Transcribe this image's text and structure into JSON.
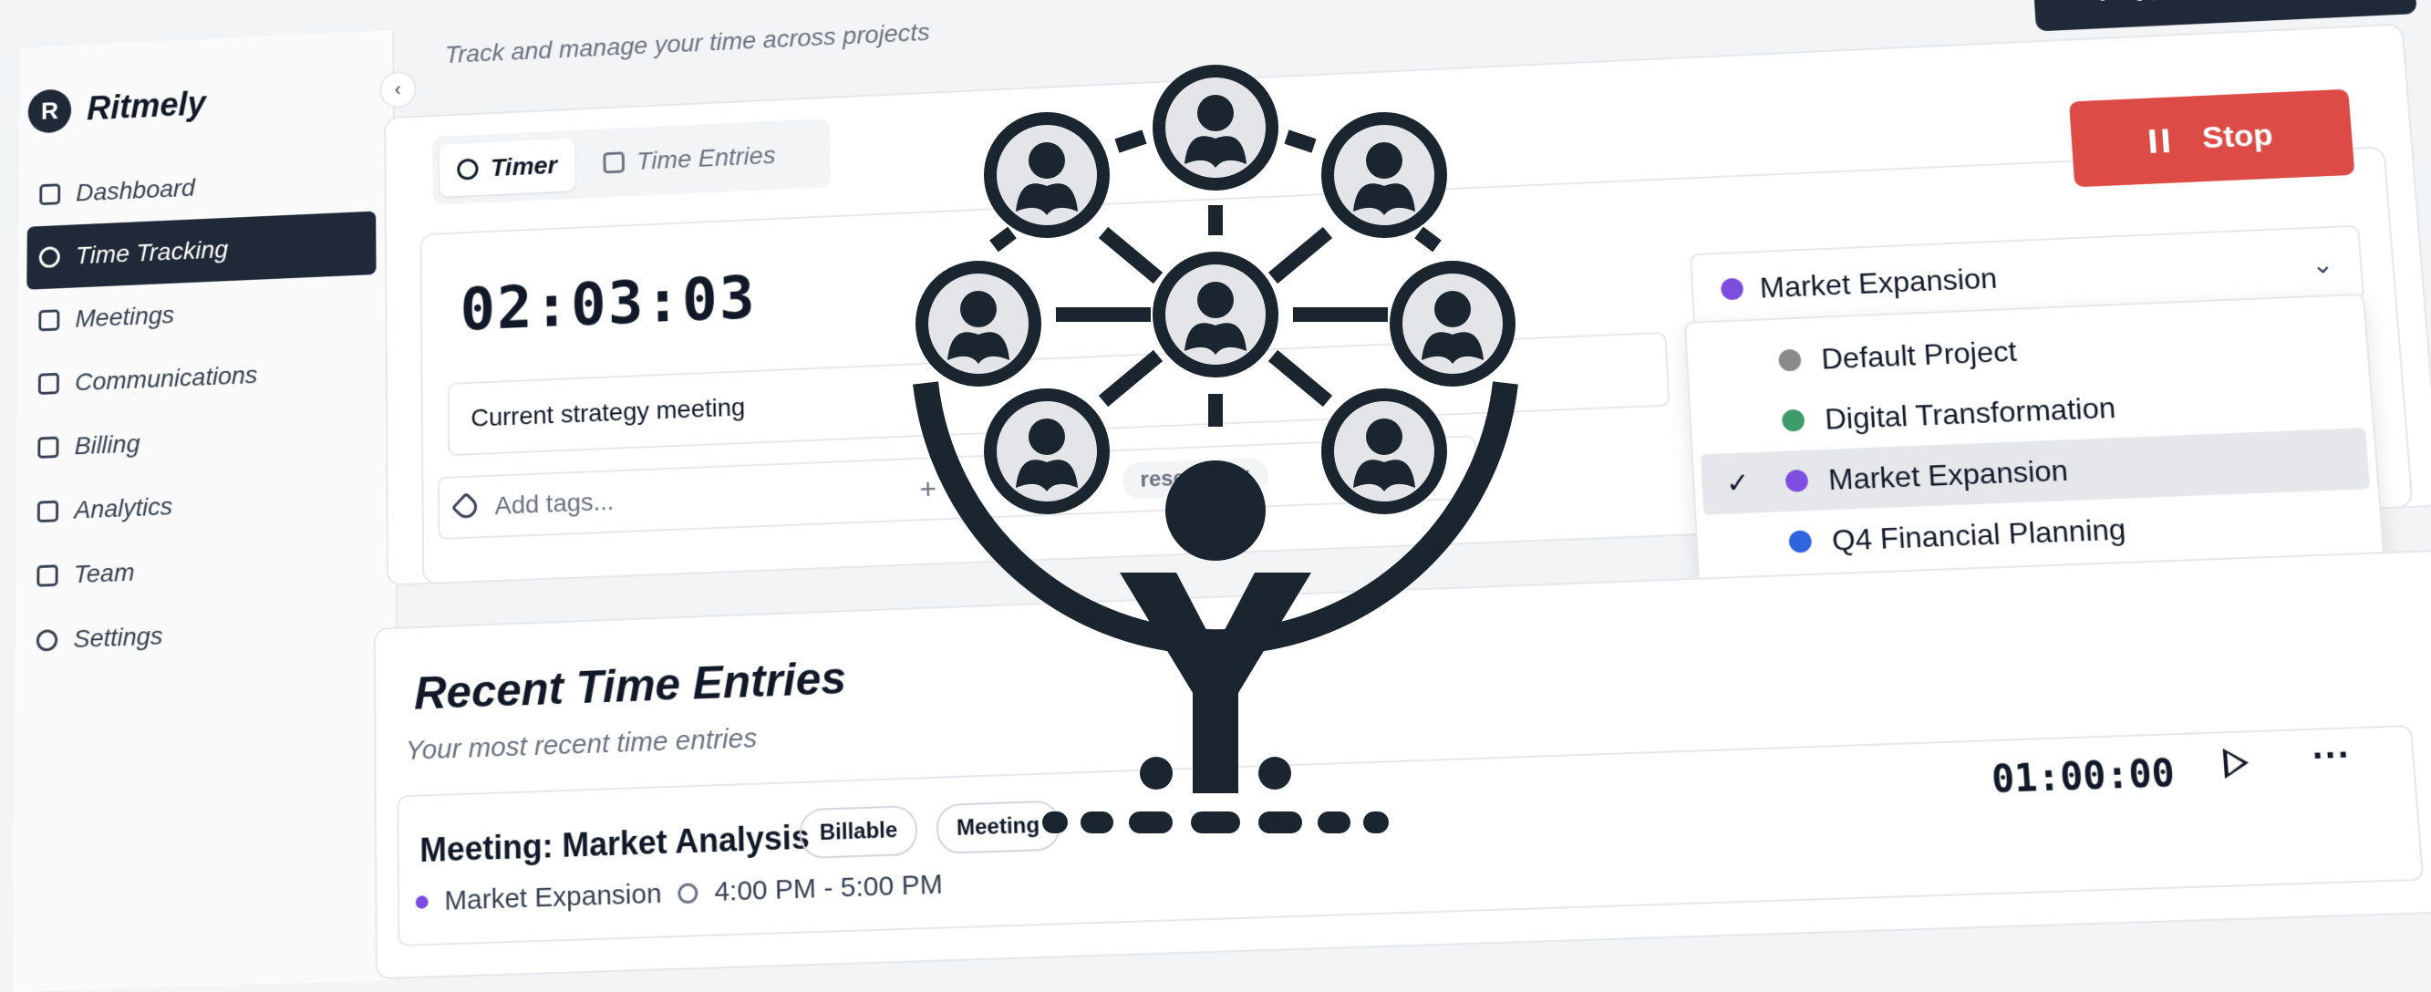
{
  "app": {
    "name": "Ritmely",
    "logo_letter": "R"
  },
  "header": {
    "subtitle": "Track and manage your time across projects",
    "add_button_label": "Add Time Entry"
  },
  "sidebar": {
    "items": [
      {
        "label": "Dashboard",
        "icon": "grid-icon"
      },
      {
        "label": "Time Tracking",
        "icon": "clock-icon",
        "active": true
      },
      {
        "label": "Meetings",
        "icon": "calendar-icon"
      },
      {
        "label": "Communications",
        "icon": "message-icon"
      },
      {
        "label": "Billing",
        "icon": "card-icon"
      },
      {
        "label": "Analytics",
        "icon": "chart-icon"
      },
      {
        "label": "Team",
        "icon": "users-icon"
      },
      {
        "label": "Settings",
        "icon": "gear-icon"
      }
    ]
  },
  "tabs": [
    {
      "label": "Timer",
      "active": true
    },
    {
      "label": "Time Entries",
      "active": false
    }
  ],
  "timer": {
    "elapsed": "02:03:03",
    "description": "Current strategy meeting",
    "tags_placeholder": "Add tags...",
    "tag_chip": "research",
    "stop_label": "Stop"
  },
  "project_select": {
    "selected": "Market Expansion",
    "selected_color": "#7c4dde",
    "options": [
      {
        "label": "Default Project",
        "color": "#8a8a8a"
      },
      {
        "label": "Digital Transformation",
        "color": "#3d9a6b"
      },
      {
        "label": "Market Expansion",
        "color": "#7c4dde",
        "selected": true
      },
      {
        "label": "Q4 Financial Planning",
        "color": "#2f63e0"
      }
    ]
  },
  "recent": {
    "title": "Recent Time Entries",
    "subtitle": "Your most recent time entries",
    "entries": [
      {
        "title": "Meeting: Market Analysis",
        "badges": [
          "Billable",
          "Meeting"
        ],
        "project": "Market Expansion",
        "project_color": "#7c4dde",
        "time_range": "4:00 PM - 5:00 PM",
        "duration": "01:00:00"
      }
    ]
  },
  "overlay": {
    "icon": "tree-network-logo-icon",
    "color": "#1a2530"
  }
}
